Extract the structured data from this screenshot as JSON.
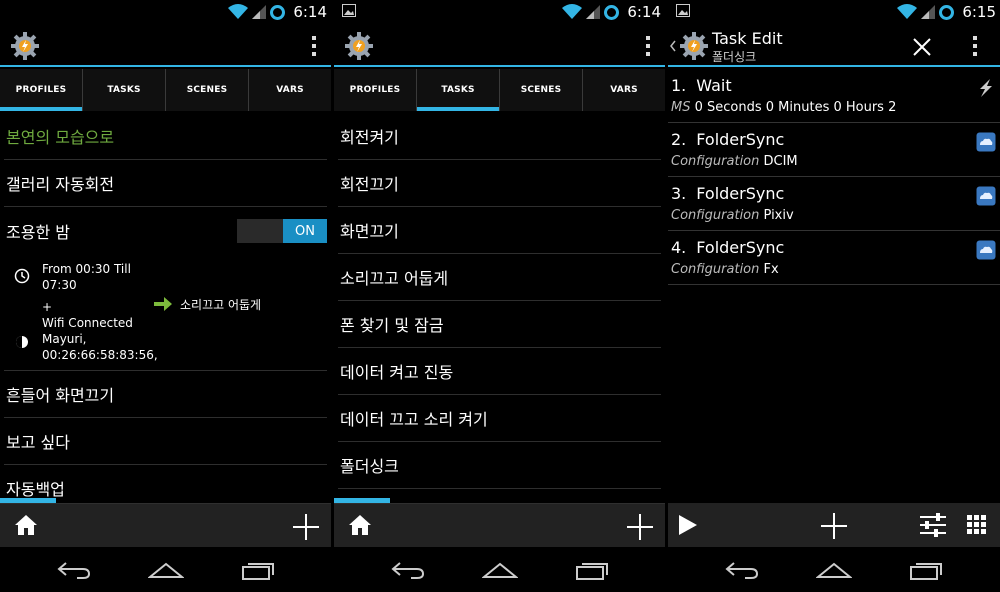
{
  "status": {
    "time_1": "6:14",
    "time_2": "6:14",
    "time_3": "6:15"
  },
  "tabs": [
    "PROFILES",
    "TASKS",
    "SCENES",
    "VARS"
  ],
  "profiles": {
    "items": [
      "본연의 모습으로",
      "갤러리 자동회전",
      "조용한 밤",
      "흔들어 화면끄기",
      "보고 싶다",
      "자동백업"
    ],
    "toggle_label": "ON",
    "context_time": "From 00:30 Till 07:30",
    "context_plus": "+",
    "context_wifi_1": "Wifi Connected",
    "context_wifi_2": "Mayuri,",
    "context_wifi_3": "00:26:66:58:83:56,",
    "linked_task": "소리끄고 어둡게"
  },
  "tasks": {
    "items": [
      "회전켜기",
      "회전끄기",
      "화면끄기",
      "소리끄고 어둡게",
      "폰 찾기 및 잠금",
      "데이터 켜고 진동",
      "데이터 끄고 소리 켜기",
      "폴더싱크"
    ]
  },
  "task_edit": {
    "title": "Task Edit",
    "subtitle": "폴더싱크",
    "actions": [
      {
        "num": "1.",
        "name": "Wait",
        "args_label": "MS",
        "args_value": "0 Seconds 0 Minutes 0 Hours 2",
        "icon": "lightning-icon"
      },
      {
        "num": "2.",
        "name": "FolderSync",
        "args_label": "Configuration",
        "args_value": "DCIM",
        "icon": "cloud-icon"
      },
      {
        "num": "3.",
        "name": "FolderSync",
        "args_label": "Configuration",
        "args_value": "Pixiv",
        "icon": "cloud-icon"
      },
      {
        "num": "4.",
        "name": "FolderSync",
        "args_label": "Configuration",
        "args_value": "Fx",
        "icon": "cloud-icon"
      }
    ]
  },
  "colors": {
    "accent": "#33b5e5",
    "active_profile": "#6faa3f",
    "toggle_on": "#1a8fc4"
  }
}
